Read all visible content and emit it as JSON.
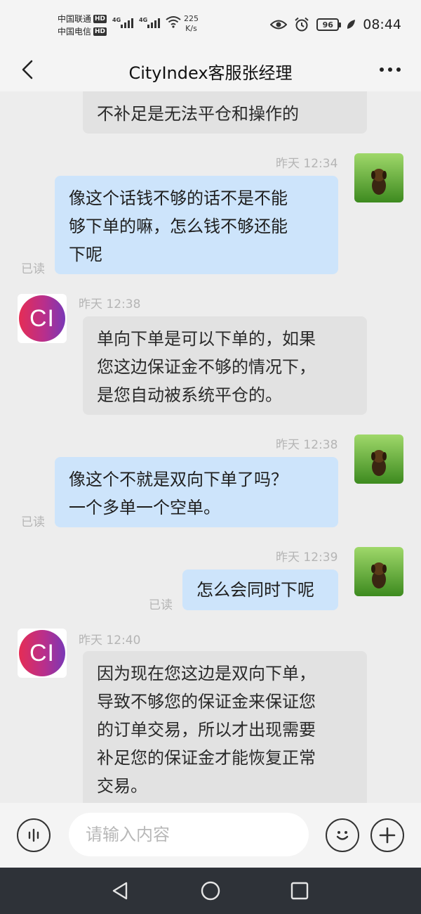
{
  "status_bar": {
    "carrier1": "中国联通",
    "carrier2": "中国电信",
    "hd_badge": "HD",
    "network_type": "4G",
    "speed_value": "225",
    "speed_unit": "K/s",
    "battery": "96",
    "time": "08:44"
  },
  "header": {
    "title": "CityIndex客服张经理"
  },
  "chat": {
    "avatar_text": "CI",
    "messages": [
      {
        "lines": [
          "不补足是无法平仓和操作的"
        ]
      },
      {
        "time": "昨天 12:34",
        "lines": [
          "像这个话钱不够的话不是不能",
          "够下单的嘛，怎么钱不够还能",
          "下呢"
        ],
        "read": "已读"
      },
      {
        "time": "昨天 12:38",
        "lines": [
          "单向下单是可以下单的，如果",
          "您这边保证金不够的情况下，",
          "是您自动被系统平仓的。"
        ]
      },
      {
        "time": "昨天 12:38",
        "lines": [
          "像这个不就是双向下单了吗？",
          "一个多单一个空单。"
        ],
        "read": "已读"
      },
      {
        "time": "昨天 12:39",
        "lines": [
          "怎么会同时下呢"
        ],
        "read": "已读"
      },
      {
        "time": "昨天 12:40",
        "lines": [
          "因为现在您这边是双向下单，",
          "导致不够您的保证金来保证您",
          "的订单交易，所以才出现需要",
          "补足您的保证金才能恢复正常",
          "交易。"
        ]
      }
    ]
  },
  "input_bar": {
    "placeholder": "请输入内容"
  },
  "icons": {
    "back": "chevron-left-icon",
    "more": "more-dots-icon",
    "voice": "voice-icon",
    "emoji": "emoji-icon",
    "add": "plus-icon",
    "nav_back": "triangle-back-icon",
    "nav_home": "circle-home-icon",
    "nav_recent": "square-recent-icon"
  },
  "colors": {
    "incoming_bubble": "#e2e2e2",
    "outgoing_bubble": "#cde4fb",
    "background": "#ededed",
    "nav_bar": "#2e3238"
  }
}
